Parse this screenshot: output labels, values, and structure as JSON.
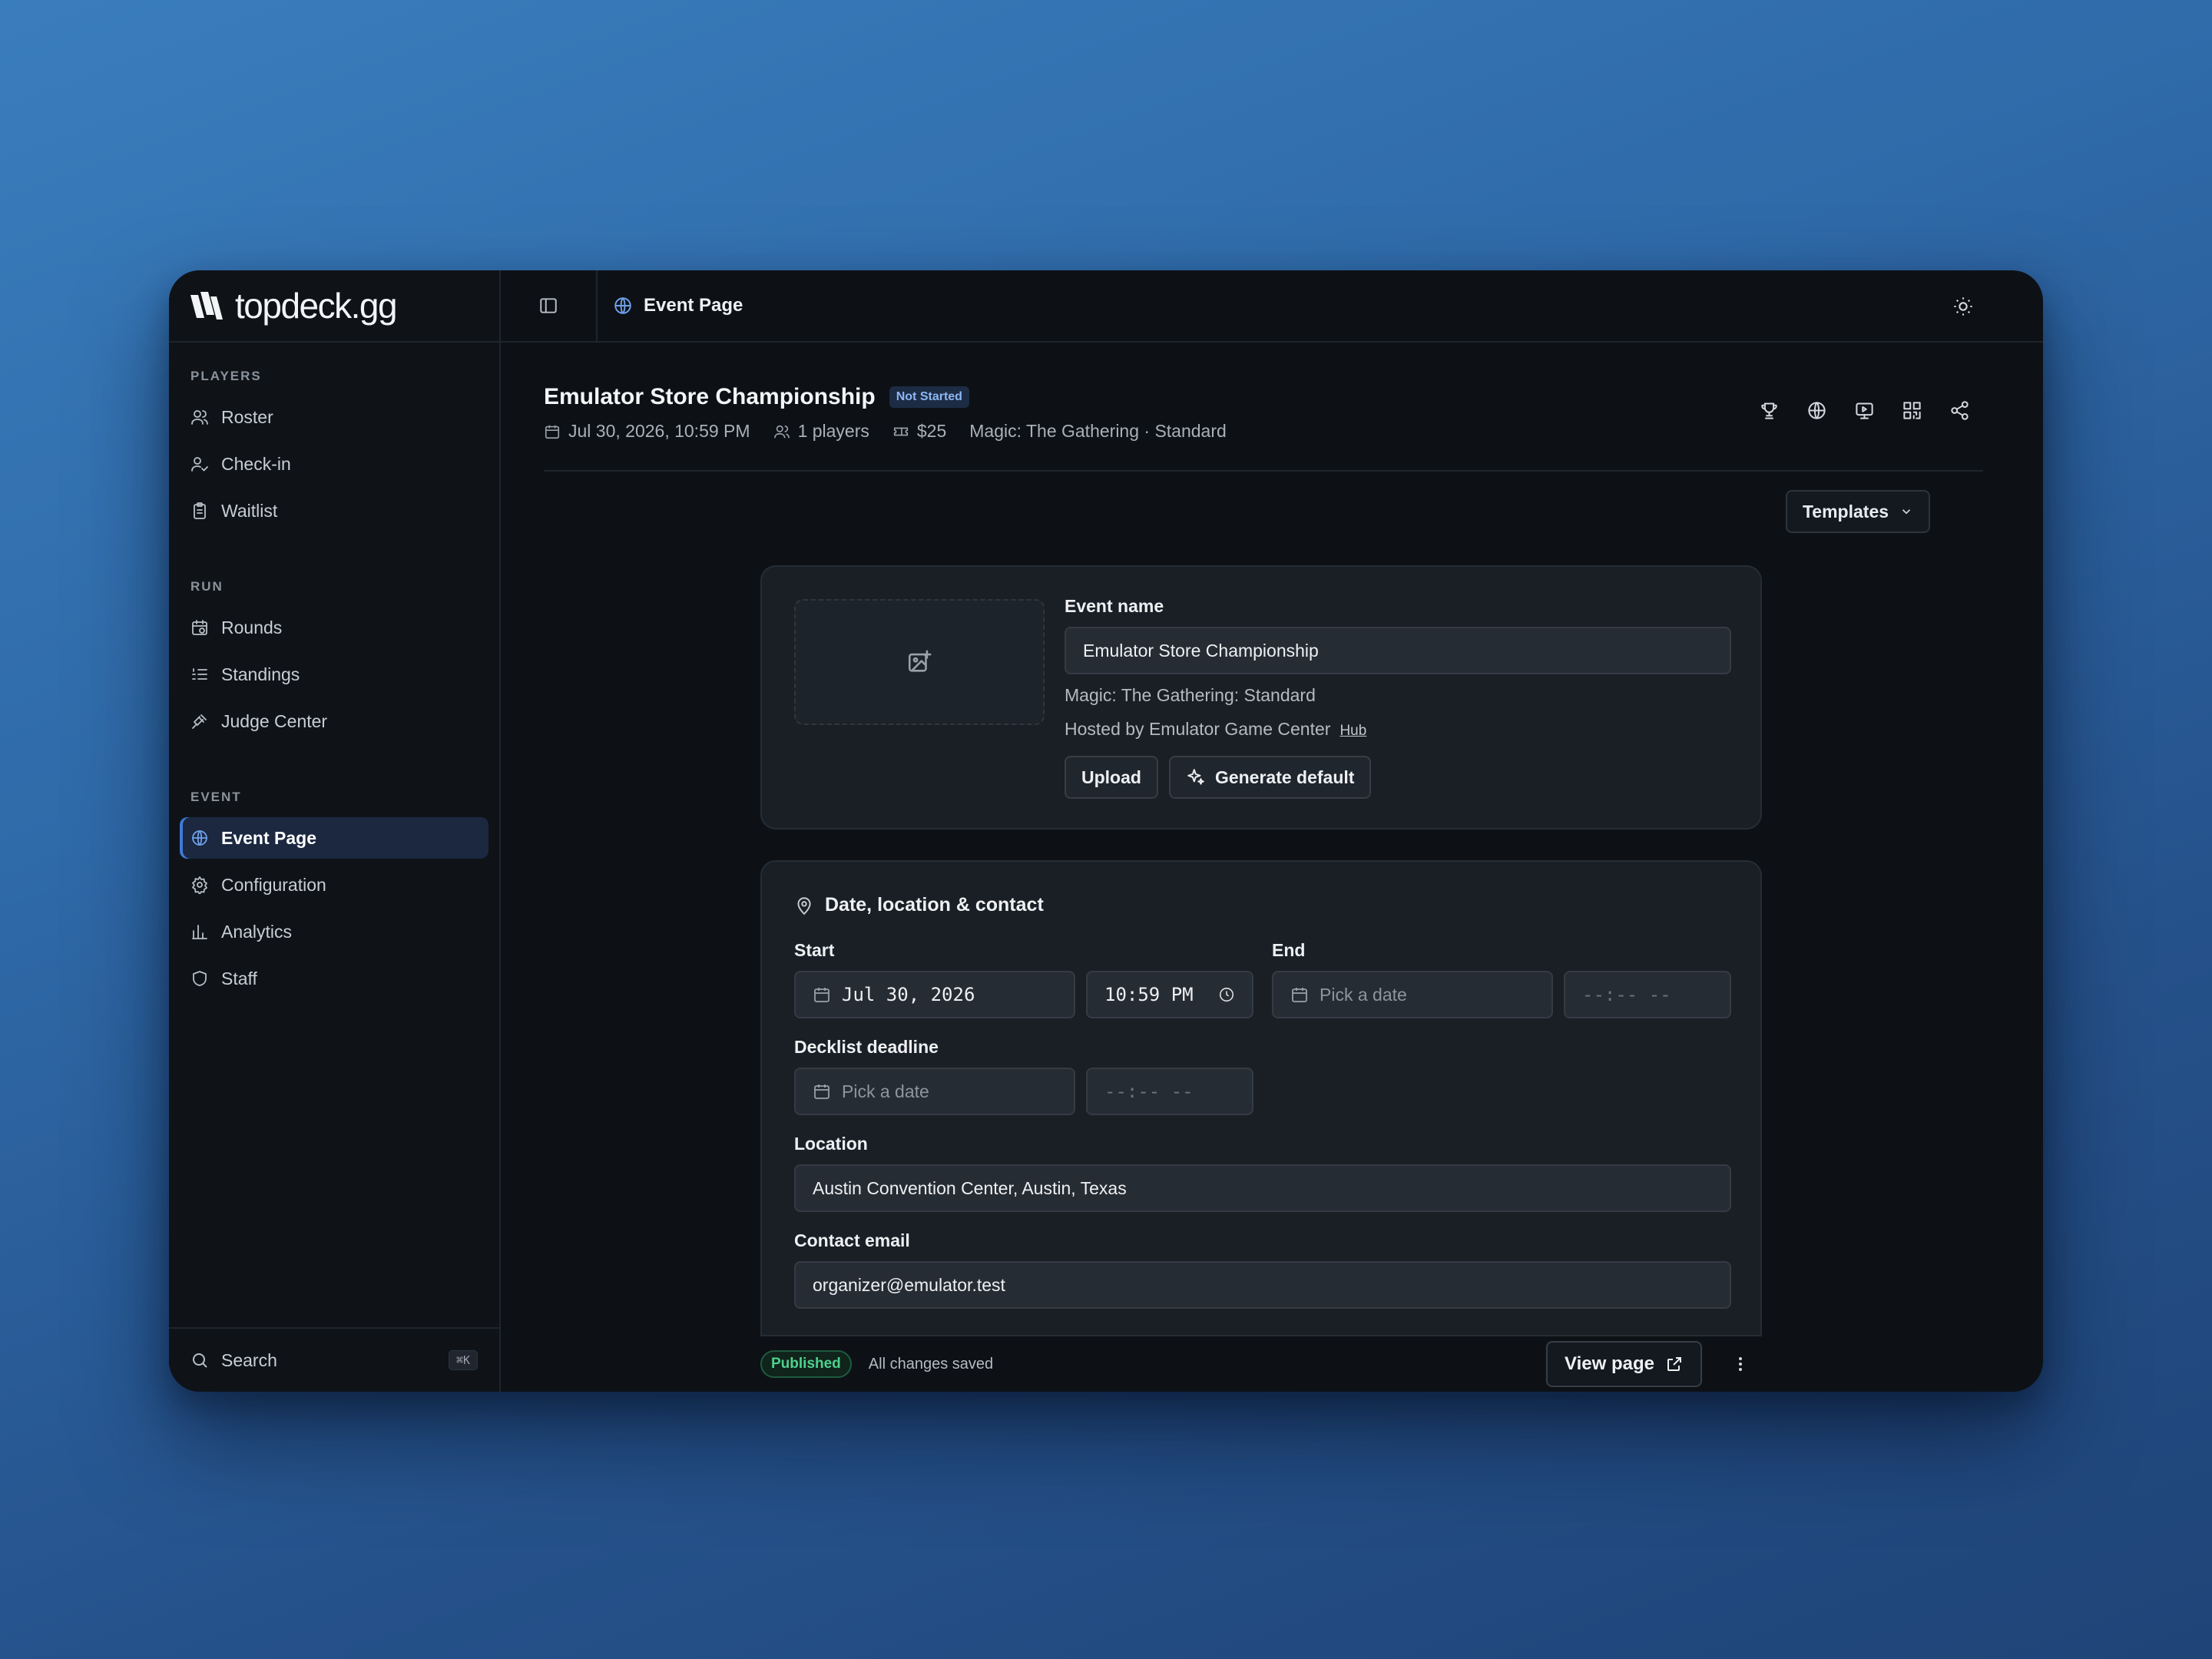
{
  "brand": {
    "name": "topdeck.gg"
  },
  "sidebar": {
    "sections": [
      {
        "heading": "PLAYERS",
        "items": [
          {
            "label": "Roster",
            "icon": "users-icon"
          },
          {
            "label": "Check-in",
            "icon": "user-check-icon"
          },
          {
            "label": "Waitlist",
            "icon": "clipboard-icon"
          }
        ]
      },
      {
        "heading": "RUN",
        "items": [
          {
            "label": "Rounds",
            "icon": "calendar-clock-icon"
          },
          {
            "label": "Standings",
            "icon": "list-ordered-icon"
          },
          {
            "label": "Judge Center",
            "icon": "gavel-icon"
          }
        ]
      },
      {
        "heading": "EVENT",
        "items": [
          {
            "label": "Event Page",
            "icon": "globe-icon",
            "active": true
          },
          {
            "label": "Configuration",
            "icon": "gear-icon"
          },
          {
            "label": "Analytics",
            "icon": "bar-chart-icon"
          },
          {
            "label": "Staff",
            "icon": "shield-icon"
          }
        ]
      }
    ],
    "search": {
      "label": "Search",
      "shortcut": "⌘K"
    }
  },
  "topbar": {
    "breadcrumb": "Event Page"
  },
  "event": {
    "title": "Emulator Store Championship",
    "status": "Not Started",
    "date": "Jul 30, 2026, 10:59 PM",
    "players": "1 players",
    "fee": "$25",
    "format": "Magic: The Gathering · Standard"
  },
  "templates_label": "Templates",
  "details_card": {
    "event_name_label": "Event name",
    "event_name_value": "Emulator Store Championship",
    "game_format": "Magic: The Gathering: Standard",
    "hosted_by": "Hosted by Emulator Game Center",
    "hub_link": "Hub",
    "upload_label": "Upload",
    "generate_label": "Generate default"
  },
  "date_card": {
    "title": "Date, location & contact",
    "start_label": "Start",
    "start_date": "Jul 30, 2026",
    "start_time": "10:59 PM",
    "end_label": "End",
    "end_date_placeholder": "Pick a date",
    "end_time_placeholder": "--:-- --",
    "deadline_label": "Decklist deadline",
    "deadline_date_placeholder": "Pick a date",
    "deadline_time_placeholder": "--:-- --",
    "location_label": "Location",
    "location_value": "Austin Convention Center, Austin, Texas",
    "contact_label": "Contact email",
    "contact_value": "organizer@emulator.test"
  },
  "footer": {
    "status_badge": "Published",
    "save_status": "All changes saved",
    "view_page_label": "View page"
  }
}
